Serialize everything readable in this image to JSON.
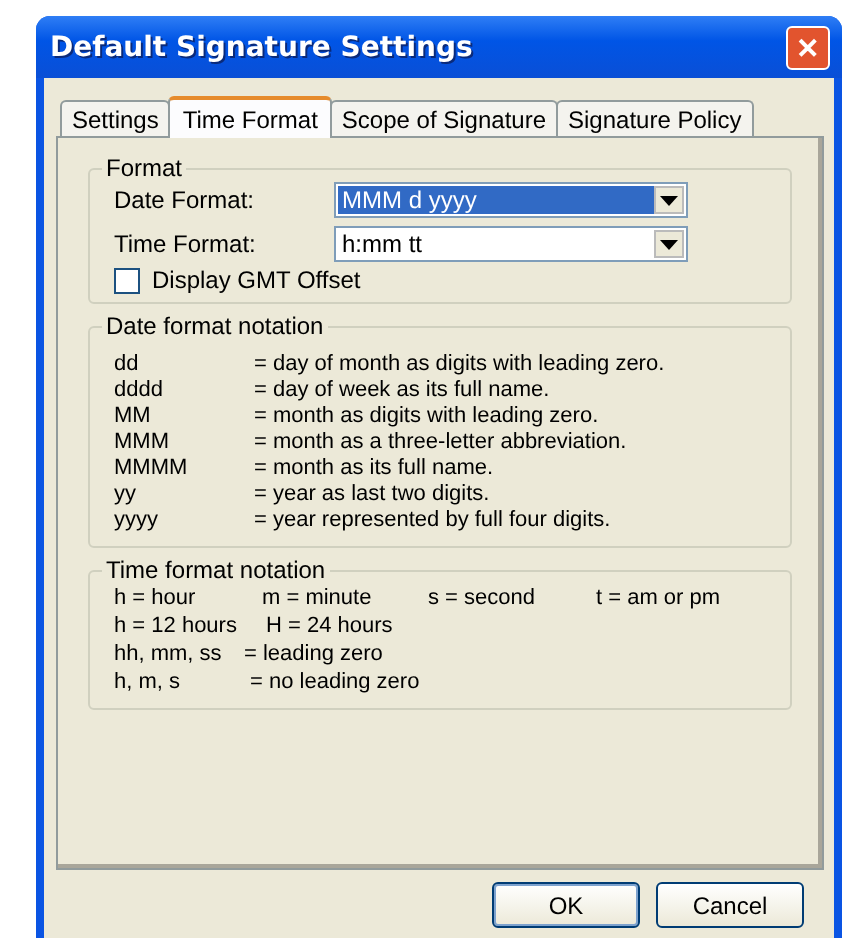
{
  "window": {
    "title": "Default Signature Settings",
    "close": "✕"
  },
  "tabs": [
    {
      "label": "Settings",
      "selected": false
    },
    {
      "label": "Time Format",
      "selected": true
    },
    {
      "label": "Scope of Signature",
      "selected": false
    },
    {
      "label": "Signature Policy",
      "selected": false
    }
  ],
  "format": {
    "legend": "Format",
    "fields": [
      {
        "label": "Date Format:",
        "value": "MMM d yyyy",
        "focused": true
      },
      {
        "label": "Time Format:",
        "value": "h:mm tt",
        "focused": false
      }
    ],
    "checkbox": {
      "label": "Display GMT Offset",
      "checked": false
    }
  },
  "date_notation": {
    "legend": "Date format notation",
    "rows": [
      [
        "dd",
        "= day of month as digits with leading zero."
      ],
      [
        "dddd",
        "= day of week as its full name."
      ],
      [
        "MM",
        "= month as digits with leading zero."
      ],
      [
        "MMM",
        "= month as a three-letter abbreviation."
      ],
      [
        "MMMM",
        "= month as its full name."
      ],
      [
        "yy",
        "= year as last two digits."
      ],
      [
        "yyyy",
        "= year represented by full four digits."
      ]
    ]
  },
  "time_notation": {
    "legend": "Time format notation",
    "lines": [
      [
        "h = hour",
        "m = minute",
        "s = second",
        "t = am or pm"
      ],
      [
        "h = 12 hours",
        "H = 24 hours"
      ],
      [
        "hh, mm, ss",
        "= leading zero"
      ],
      [
        "h, m, s",
        "= no leading zero"
      ]
    ]
  },
  "buttons": [
    {
      "label": "OK",
      "default": true
    },
    {
      "label": "Cancel",
      "default": false
    }
  ]
}
